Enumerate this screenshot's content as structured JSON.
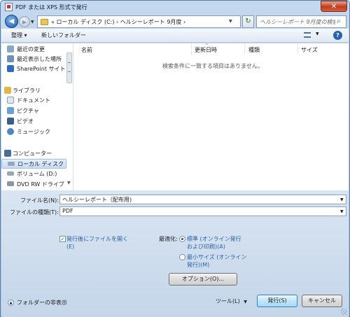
{
  "window": {
    "title": "PDF または XPS 形式で発行",
    "close_glyph": "✕"
  },
  "nav": {
    "back_glyph": "◀",
    "forward_glyph": "▶",
    "path": "« ローカル ディスク (C:) › ヘルシーレポート 9月度 ›",
    "refresh_glyph": "↻",
    "search_placeholder": "ヘルシーレポート 9月度の検索"
  },
  "toolbar": {
    "organize": "整理 ▾",
    "new_folder": "新しいフォルダー",
    "help": "?"
  },
  "sidebar": {
    "items": [
      {
        "label": "最近の変更",
        "icon": "recent-changes-icon",
        "color": "#8aa6c8"
      },
      {
        "label": "最近表示した場所",
        "icon": "recent-places-icon",
        "color": "#6e8fb8"
      },
      {
        "label": "SharePoint サイト",
        "icon": "sharepoint-icon",
        "color": "#2e6cc0"
      },
      {
        "label": "ライブラリ",
        "icon": "library-icon",
        "color": "#e0b94a"
      },
      {
        "label": "ドキュメント",
        "icon": "documents-icon",
        "color": "#dfe7f1"
      },
      {
        "label": "ピクチャ",
        "icon": "pictures-icon",
        "color": "#6aa0d4"
      },
      {
        "label": "ビデオ",
        "icon": "videos-icon",
        "color": "#3a5d8c"
      },
      {
        "label": "ミュージック",
        "icon": "music-icon",
        "color": "#4d86c6"
      },
      {
        "label": "コンピューター",
        "icon": "computer-icon",
        "color": "#4a6d95"
      },
      {
        "label": "ローカル ディスク (C:)",
        "icon": "local-disk-icon",
        "color": "#9aa6b3"
      },
      {
        "label": "ボリューム (D:)",
        "icon": "volume-icon",
        "color": "#9aa6b3"
      },
      {
        "label": "DVD RW ドライブ (E:)",
        "icon": "dvd-drive-icon",
        "color": "#8a96a3"
      }
    ]
  },
  "list": {
    "columns": [
      "名前",
      "更新日時",
      "種類",
      "サイズ"
    ],
    "empty_message": "検索条件に一致する項目はありません。"
  },
  "form": {
    "filename_label": "ファイル名(N):",
    "filename_value": "ヘルシーレポート（配布用)",
    "filetype_label": "ファイルの種類(T):",
    "filetype_value": "PDF",
    "open_after_publish_line1": "発行後にファイルを開く",
    "open_after_publish_line2": "(E)",
    "open_after_publish_checked": true,
    "optimize_label": "最適化:",
    "optimize_standard_line1": "標準 (オンライン発行",
    "optimize_standard_line2": "および印刷)(A)",
    "optimize_min_line1": "最小サイズ (オンライン",
    "optimize_min_line2": "発行)(M)",
    "options_button": "オプション(O)...",
    "tools": "ツール(L)",
    "publish_button": "発行(S)",
    "cancel_button": "キャンセル",
    "hide_folders": "フォルダーの非表示"
  }
}
